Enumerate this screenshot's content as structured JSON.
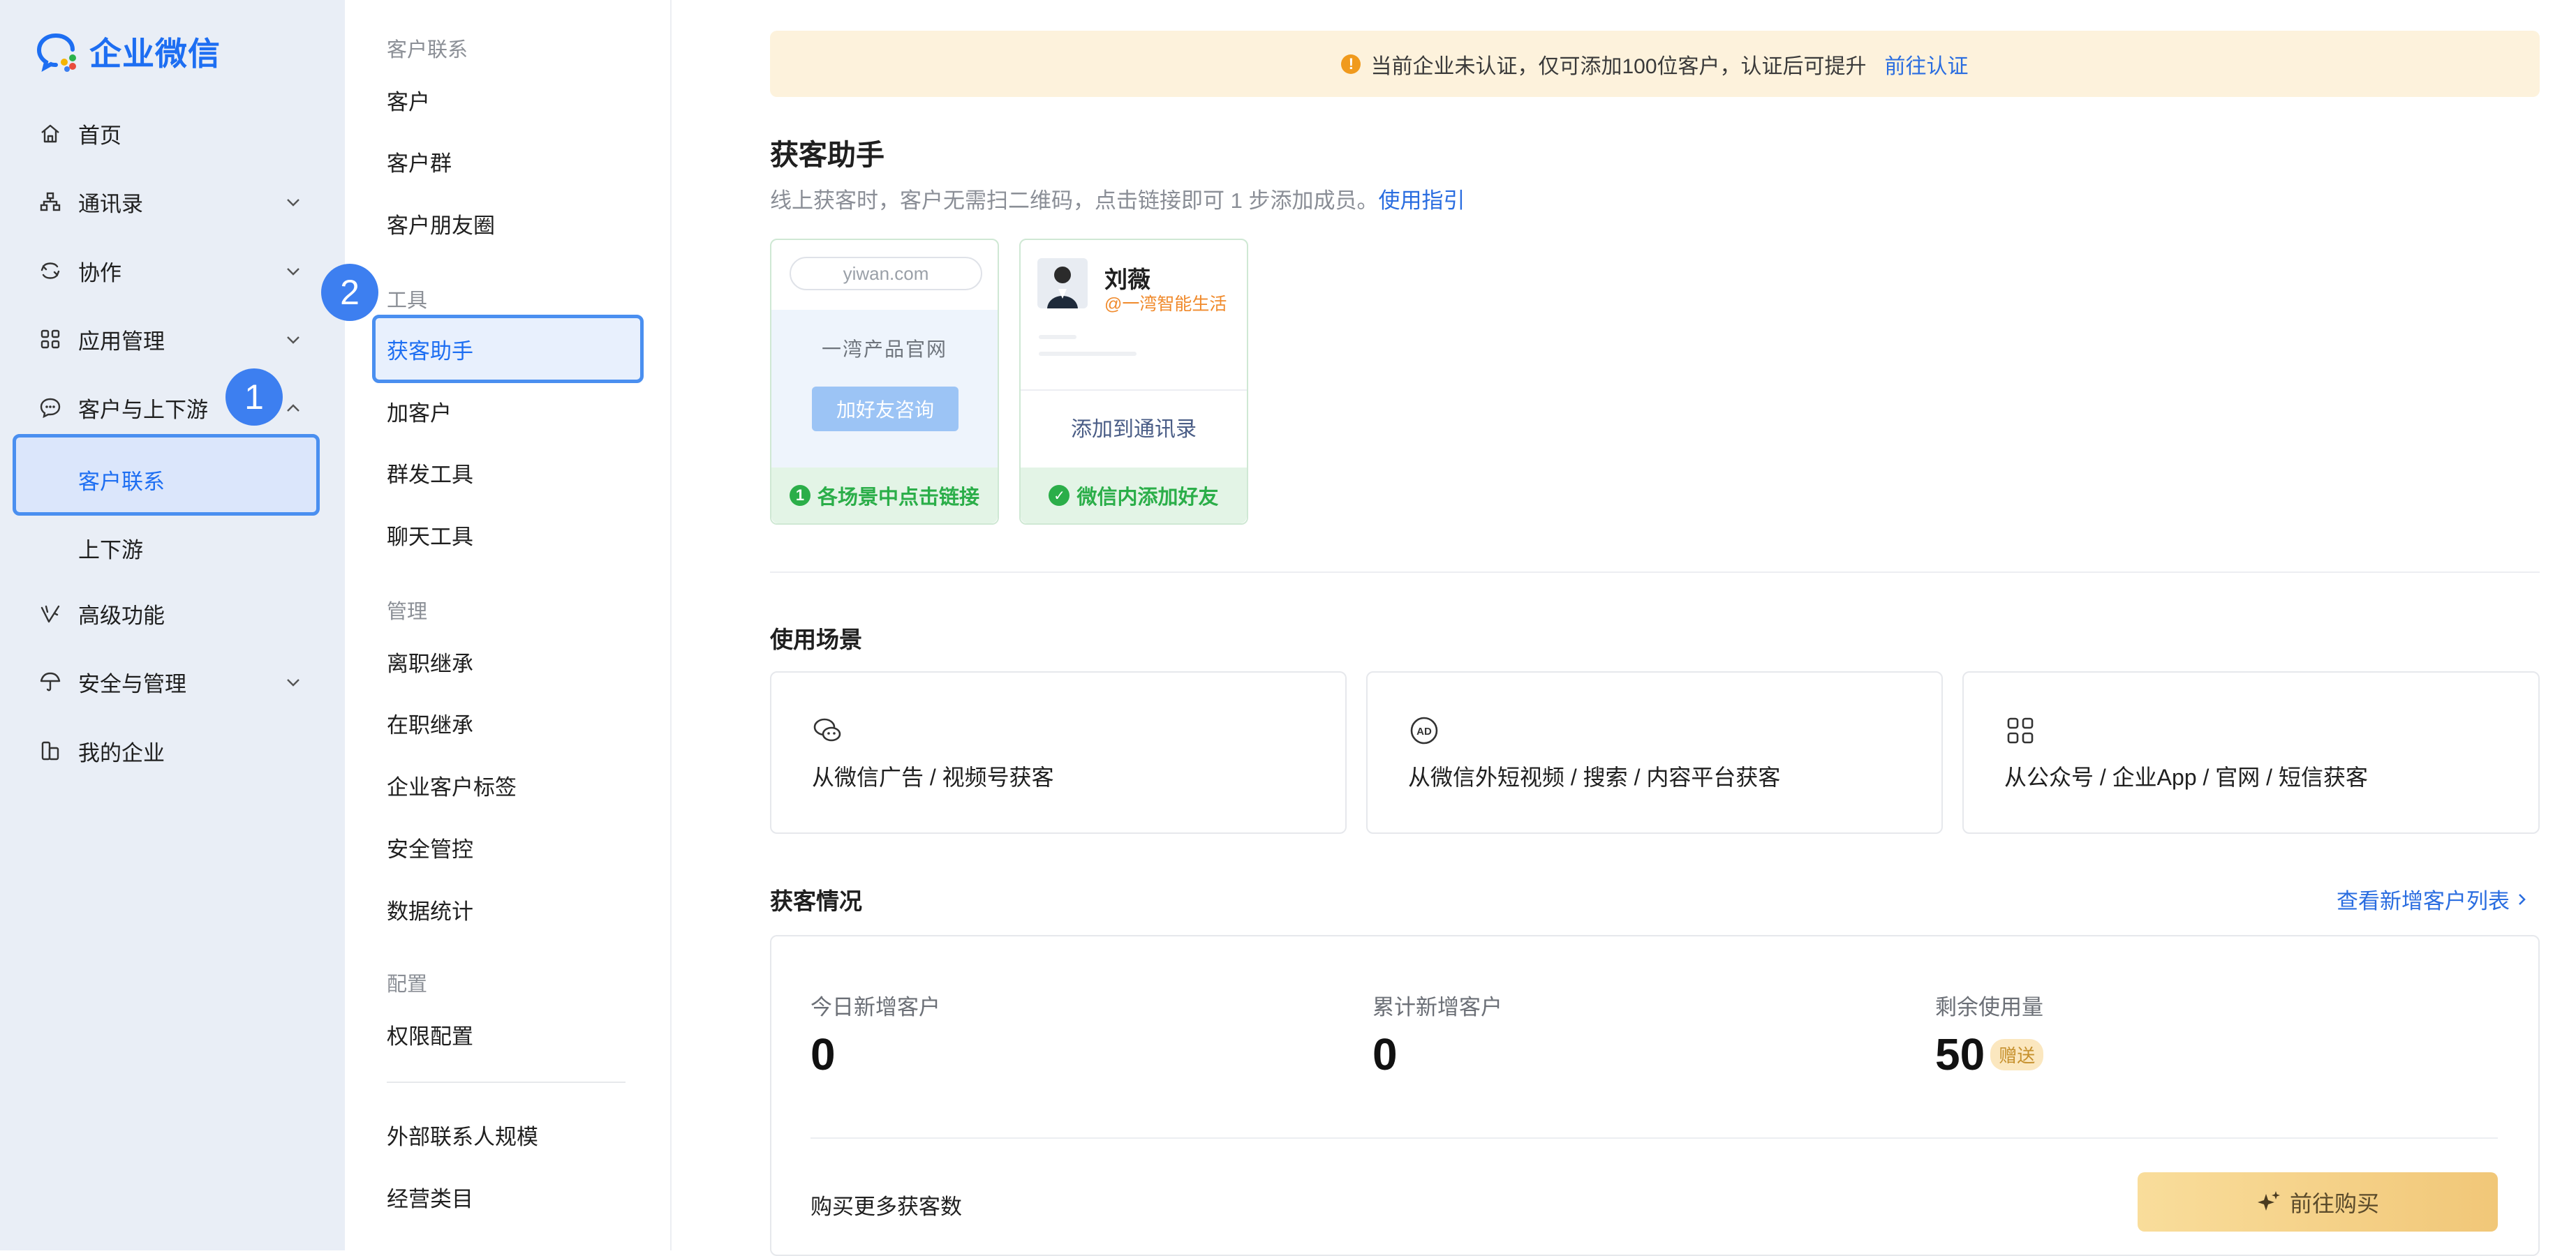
{
  "app": {
    "name": "企业微信",
    "brand_color": "#1d6ef2"
  },
  "sidebar": {
    "items": [
      {
        "label": "首页",
        "icon": "home-icon"
      },
      {
        "label": "通讯录",
        "icon": "org-chart-icon",
        "expandable": true
      },
      {
        "label": "协作",
        "icon": "collab-icon",
        "expandable": true
      },
      {
        "label": "应用管理",
        "icon": "grid-icon",
        "expandable": true
      },
      {
        "label": "客户与上下游",
        "icon": "chat-bubble-icon",
        "expandable": true,
        "expanded": true
      },
      {
        "label": "客户联系",
        "sub": true,
        "active": true
      },
      {
        "label": "上下游",
        "sub": true
      },
      {
        "label": "高级功能",
        "icon": "advanced-icon"
      },
      {
        "label": "安全与管理",
        "icon": "umbrella-icon",
        "expandable": true
      },
      {
        "label": "我的企业",
        "icon": "building-icon"
      }
    ]
  },
  "markers": {
    "m1": "1",
    "m2": "2"
  },
  "subnav": {
    "section1_title": "客户联系",
    "section1": [
      "客户",
      "客户群",
      "客户朋友圈"
    ],
    "section2_title": "工具",
    "section2": [
      "获客助手",
      "加客户",
      "群发工具",
      "聊天工具"
    ],
    "section3_title": "管理",
    "section3": [
      "离职继承",
      "在职继承",
      "企业客户标签",
      "安全管控",
      "数据统计"
    ],
    "section4_title": "配置",
    "section4": [
      "权限配置"
    ],
    "section5": [
      "外部联系人规模",
      "经营类目"
    ]
  },
  "banner": {
    "text": "当前企业未认证，仅可添加100位客户，认证后可提升",
    "link": "前往认证",
    "icon": "warning-icon"
  },
  "page": {
    "title": "获客助手",
    "desc": "线上获客时，客户无需扫二维码，点击链接即可 1 步添加成员。",
    "desc_link": "使用指引"
  },
  "illustration": {
    "card1": {
      "url": "yiwan.com",
      "site": "一湾产品官网",
      "button": "加好友咨询",
      "step": "各场景中点击链接"
    },
    "card2": {
      "name": "刘薇",
      "company": "@一湾智能生活",
      "action": "添加到通讯录",
      "step": "微信内添加好友"
    }
  },
  "scenes": {
    "title": "使用场景",
    "items": [
      {
        "text": "从微信广告 / 视频号获客",
        "icon": "wechat-icon"
      },
      {
        "text": "从微信外短视频 / 搜索 / 内容平台获客",
        "icon": "ad-icon"
      },
      {
        "text": "从公众号 / 企业App / 官网 / 短信获客",
        "icon": "apps-grid-icon"
      }
    ]
  },
  "stats": {
    "title": "获客情况",
    "link": "查看新增客户列表",
    "today_label": "今日新增客户",
    "today_value": "0",
    "total_label": "累计新增客户",
    "total_value": "0",
    "remaining_label": "剩余使用量",
    "remaining_value": "50",
    "gift": "赠送",
    "buy_label": "购买更多获客数",
    "buy_button": "前往购买"
  }
}
